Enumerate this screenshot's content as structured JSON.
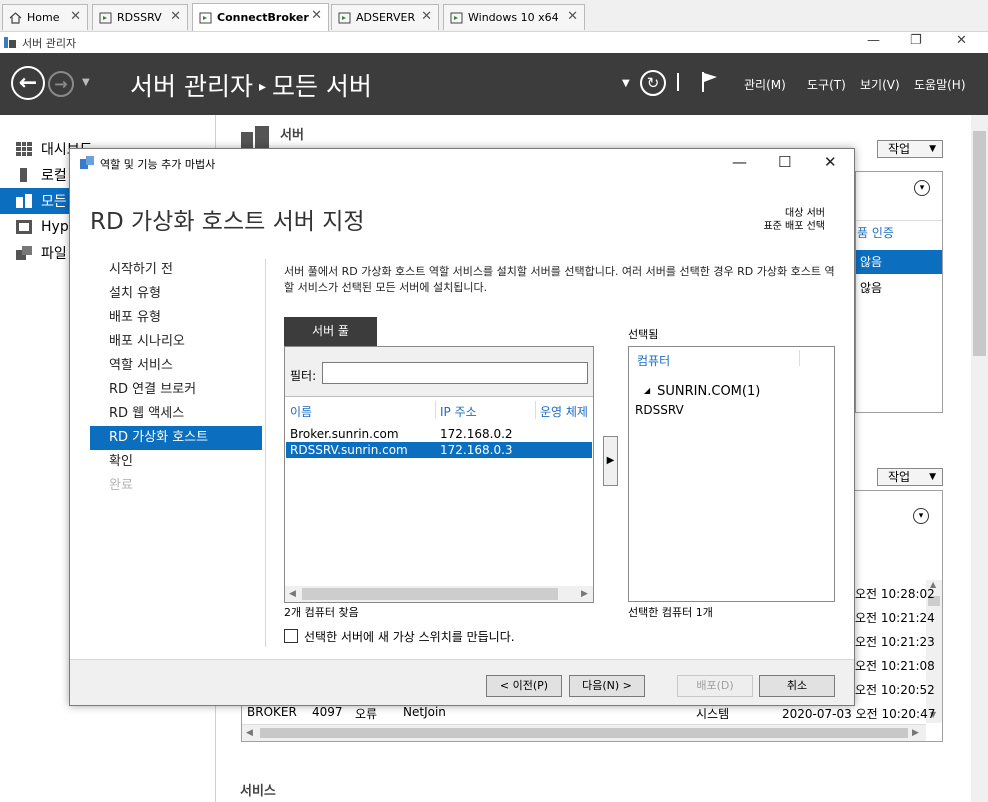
{
  "tabs": [
    {
      "label": "Home",
      "icon": "home-icon"
    },
    {
      "label": "RDSSRV",
      "icon": "vm-icon"
    },
    {
      "label": "ConnectBroker",
      "icon": "vm-icon"
    },
    {
      "label": "ADSERVER",
      "icon": "vm-icon"
    },
    {
      "label": "Windows 10 x64",
      "icon": "vm-icon"
    }
  ],
  "tab_close": "✕",
  "window": {
    "title": "서버 관리자"
  },
  "header": {
    "breadcrumb_root": "서버 관리자",
    "breadcrumb_sep": "▸",
    "breadcrumb_current": "모든 서버",
    "menus": [
      "관리(M)",
      "도구(T)",
      "보기(V)",
      "도움말(H)"
    ]
  },
  "leftnav": {
    "items": [
      {
        "label": "대시보드",
        "icon": "dashboard-icon"
      },
      {
        "label": "로컬",
        "icon": "local-server-icon"
      },
      {
        "label": "모든",
        "icon": "all-servers-icon"
      },
      {
        "label": "Hype",
        "icon": "hyperv-icon"
      },
      {
        "label": "파일",
        "icon": "file-services-icon"
      }
    ],
    "selected_index": 2
  },
  "background": {
    "servers_title": "서버",
    "task_label": "작업",
    "col_fragment": "품 인증",
    "row_fragment_1": "않음",
    "row_fragment_2": "않음",
    "services_title": "서비스",
    "events": [
      {
        "time": "오전 10:28:02"
      },
      {
        "time": "오전 10:21:24"
      },
      {
        "time": "오전 10:21:23"
      },
      {
        "time": "오전 10:21:08"
      },
      {
        "time": "오전 10:20:52"
      }
    ],
    "last_event": {
      "server": "BROKER",
      "id": "4097",
      "level": "오류",
      "source": "NetJoin",
      "log": "시스템",
      "datetime": "2020-07-03 오전 10:20:47"
    }
  },
  "wizard": {
    "title": "역할 및 기능 추가 마법사",
    "heading": "RD 가상화 호스트 서버 지정",
    "dest_label": "대상 서버",
    "dest_value": "표준 배포 선택",
    "steps": [
      "시작하기 전",
      "설치 유형",
      "배포 유형",
      "배포 시나리오",
      "역할 서비스",
      "RD 연결 브로커",
      "RD 웹 액세스",
      "RD 가상화 호스트",
      "확인",
      "완료"
    ],
    "current_step": 7,
    "description": "서버 풀에서 RD 가상화 호스트 역할 서비스를 설치할 서버를 선택합니다. 여러 서버를 선택한 경우 RD 가상화 호스트 역할 서비스가 선택된 모든 서버에 설치됩니다.",
    "pool_tab": "서버 풀",
    "filter_label": "필터:",
    "filter_value": "",
    "columns": [
      "이름",
      "IP 주소",
      "운영 체제"
    ],
    "servers": [
      {
        "name": "Broker.sunrin.com",
        "ip": "172.168.0.2"
      },
      {
        "name": "RDSSRV.sunrin.com",
        "ip": "172.168.0.3"
      }
    ],
    "selected_server_index": 1,
    "found_count": "2개 컴퓨터 찾음",
    "selected_label": "선택됨",
    "selected_column": "컴퓨터",
    "selected_domain": "SUNRIN.COM(1)",
    "selected_items": [
      "RDSSRV"
    ],
    "selected_count": "선택한 컴퓨터 1개",
    "vswitch_label": "선택한 서버에 새 가상 스위치를 만듭니다.",
    "vswitch_checked": false,
    "buttons": {
      "prev": "< 이전(P)",
      "next": "다음(N) >",
      "deploy": "배포(D)",
      "cancel": "취소"
    }
  },
  "colors": {
    "accent": "#0b6ebf",
    "header_bg": "#3c3c3c",
    "link": "#1c6dc4"
  }
}
